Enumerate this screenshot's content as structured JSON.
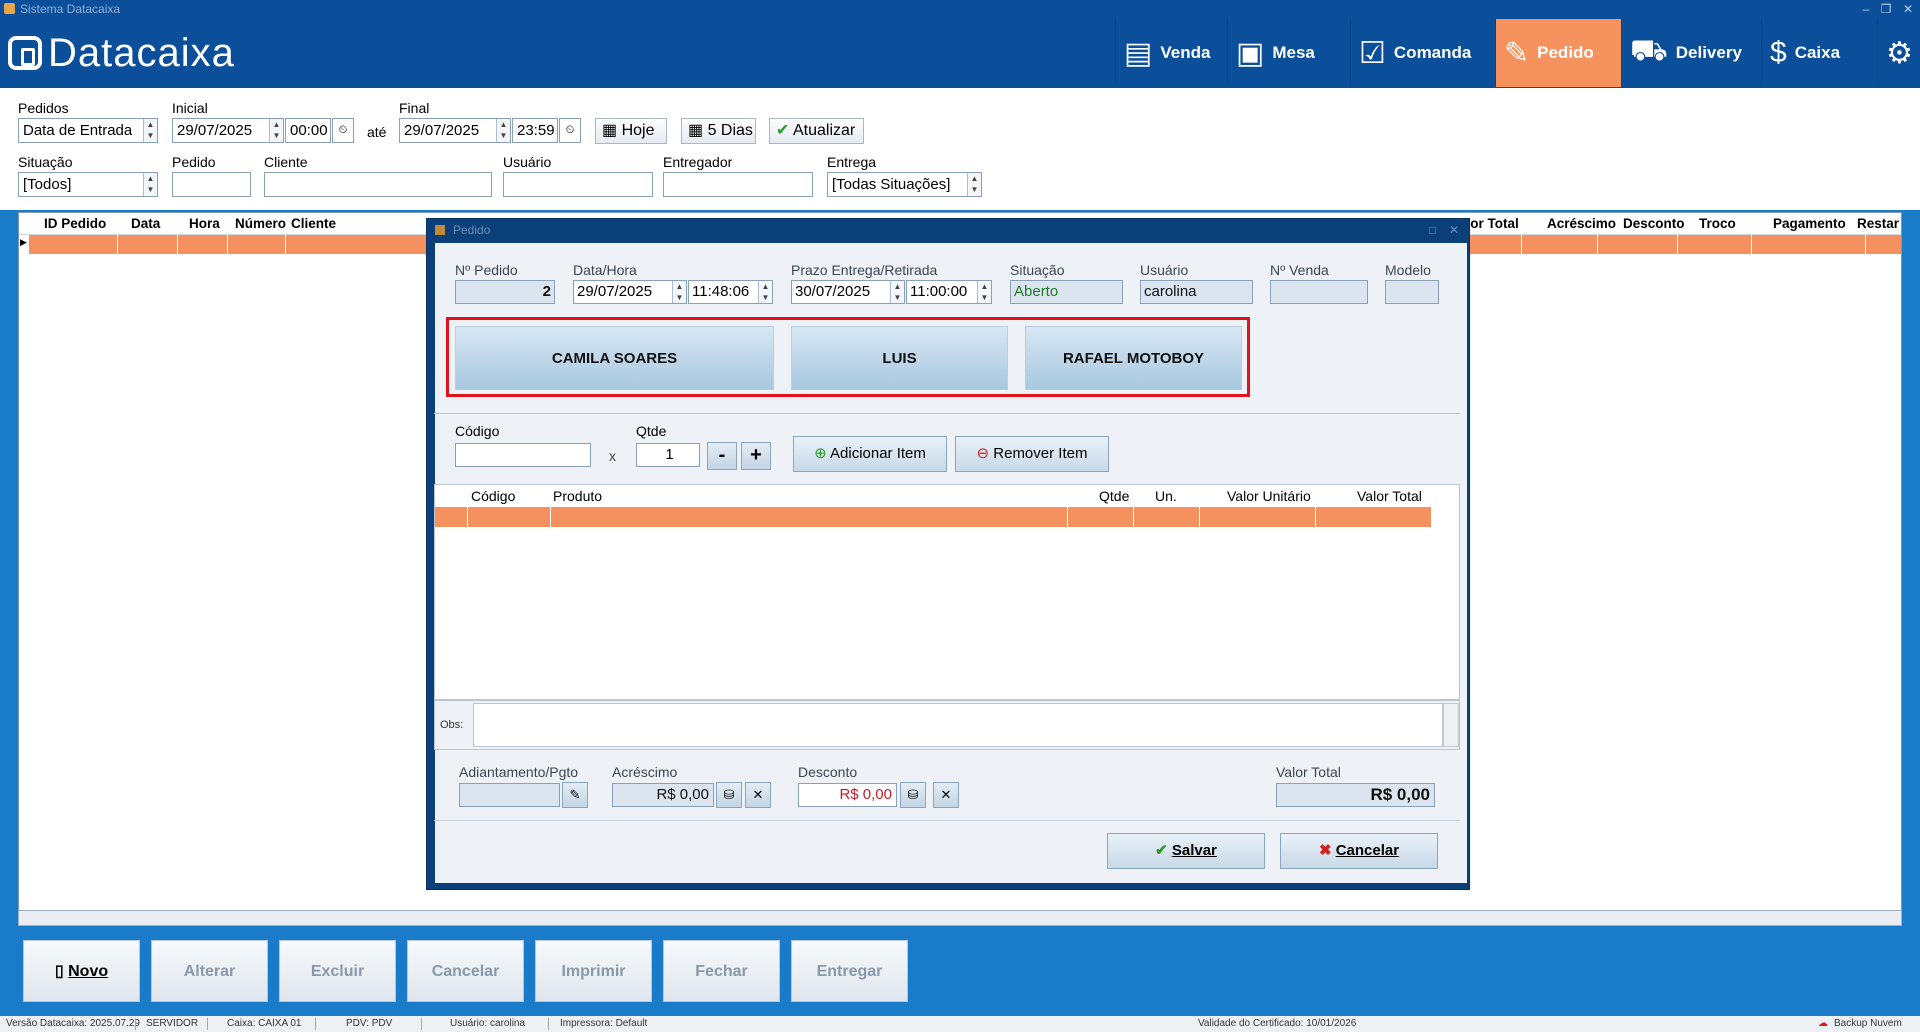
{
  "window": {
    "title": "Sistema Datacaixa"
  },
  "brand": {
    "name": "Datacaixa"
  },
  "nav": [
    {
      "label": "Venda",
      "icon": "cash-register-icon"
    },
    {
      "label": "Mesa",
      "icon": "table-icon"
    },
    {
      "label": "Comanda",
      "icon": "checklist-icon"
    },
    {
      "label": "Pedido",
      "icon": "order-icon",
      "active": true
    },
    {
      "label": "Delivery",
      "icon": "delivery-truck-icon"
    },
    {
      "label": "Caixa",
      "icon": "dollar-icon"
    },
    {
      "label": "",
      "icon": "settings-gears-icon"
    }
  ],
  "filters": {
    "pedidos_label": "Pedidos",
    "pedidos_value": "Data de Entrada",
    "inicial_label": "Inicial",
    "inicial_date": "29/07/2025",
    "inicial_time": "00:00",
    "ate_label": "até",
    "final_label": "Final",
    "final_date": "29/07/2025",
    "final_time": "23:59",
    "hoje": "Hoje",
    "cinco_dias": "5 Dias",
    "atualizar": "Atualizar",
    "situacao_label": "Situação",
    "situacao_value": "[Todos]",
    "pedido_label": "Pedido",
    "pedido_value": "",
    "cliente_label": "Cliente",
    "cliente_value": "",
    "usuario_label": "Usuário",
    "usuario_value": "",
    "entregador_label": "Entregador",
    "entregador_value": "",
    "entrega_label": "Entrega",
    "entrega_value": "[Todas Situações]"
  },
  "grid": {
    "columns_left": [
      "ID Pedido",
      "Data",
      "Hora",
      "Número",
      "Cliente"
    ],
    "columns_right": [
      "alor Total",
      "Acréscimo",
      "Desconto",
      "Troco",
      "Pagamento",
      "Restar"
    ]
  },
  "dialog": {
    "title": "Pedido",
    "nro_label": "Nº Pedido",
    "nro_value": "2",
    "datahora_label": "Data/Hora",
    "date": "29/07/2025",
    "time": "11:48:06",
    "prazo_label": "Prazo Entrega/Retirada",
    "prazo_date": "30/07/2025",
    "prazo_time": "11:00:00",
    "situacao_label": "Situação",
    "situacao_value": "Aberto",
    "usuario_label": "Usuário",
    "usuario_value": "carolina",
    "venda_label": "Nº Venda",
    "venda_value": "",
    "modelo_label": "Modelo",
    "modelo_value": "",
    "entregadores": [
      "CAMILA SOARES",
      "LUIS",
      "RAFAEL MOTOBOY"
    ],
    "codigo_label": "Código",
    "qtde_label": "Qtde",
    "qtde_value": "1",
    "x": "x",
    "minus": "-",
    "plus": "+",
    "adicionar": "Adicionar Item",
    "remover": "Remover Item",
    "items_columns": [
      "Código",
      "Produto",
      "Qtde",
      "Un.",
      "Valor Unitário",
      "Valor Total"
    ],
    "obs_label": "Obs:",
    "adiantamento_label": "Adiantamento/Pgto",
    "acrescimo_label": "Acréscimo",
    "acrescimo_value": "R$ 0,00",
    "desconto_label": "Desconto",
    "desconto_value": "R$ 0,00",
    "valor_total_label": "Valor Total",
    "valor_total_value": "R$ 0,00",
    "salvar": "Salvar",
    "cancelar": "Cancelar"
  },
  "actions": [
    "Novo",
    "Alterar",
    "Excluir",
    "Cancelar",
    "Imprimir",
    "Fechar",
    "Entregar"
  ],
  "status": {
    "versao": "Versão Datacaixa: 2025.07.29",
    "servidor": "SERVIDOR",
    "caixa": "Caixa: CAIXA 01",
    "pdv": "PDV: PDV",
    "usuario": "Usuário: carolina",
    "impressora": "Impressora: Default",
    "certificado": "Validade do Certificado: 10/01/2026",
    "backup": "Backup Nuvem"
  },
  "colors": {
    "header": "#0b4f9a",
    "accent": "#f5925d",
    "row_highlight": "#f4915f",
    "body": "#1a7bc8"
  }
}
